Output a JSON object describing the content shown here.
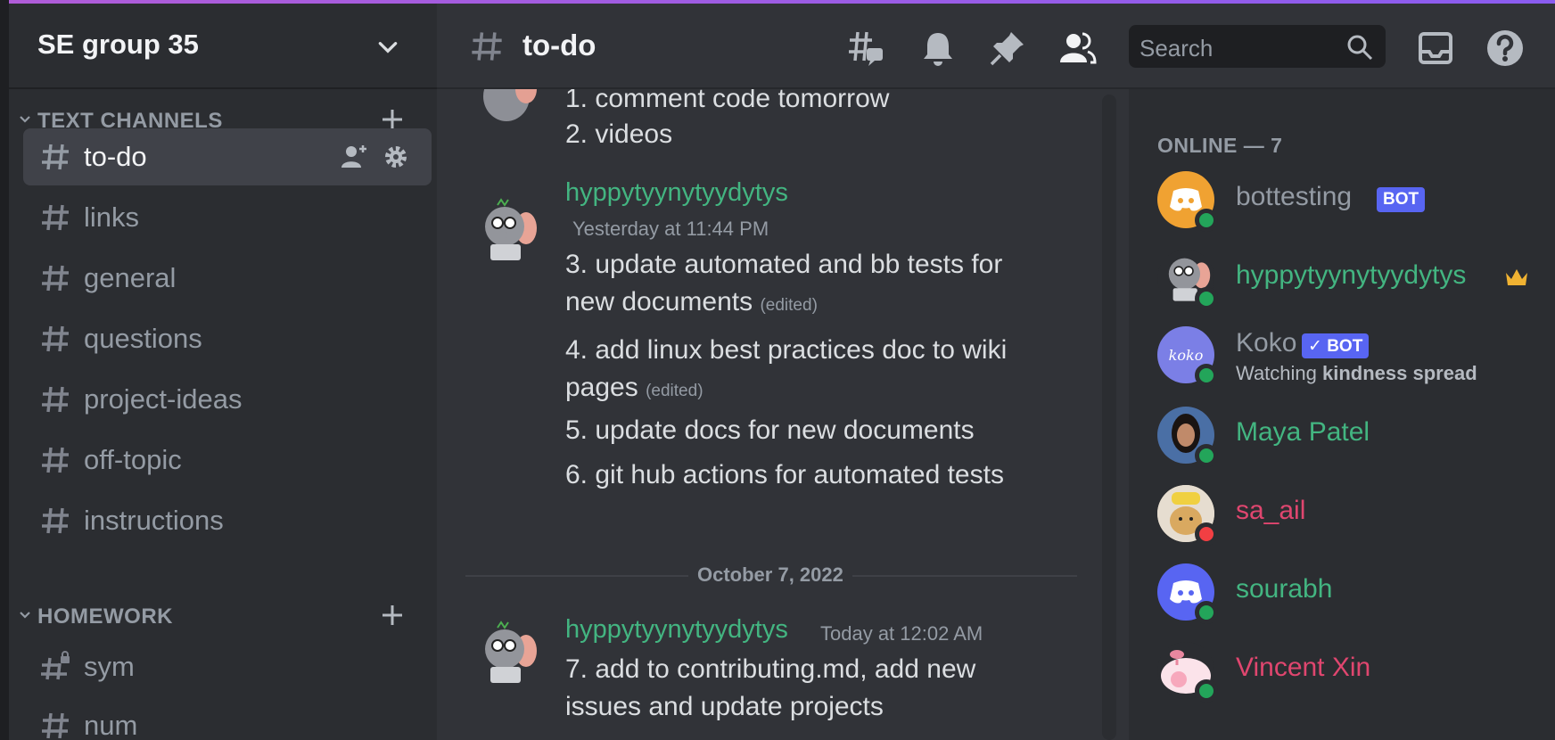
{
  "server": {
    "name": "SE group 35"
  },
  "sidebar": {
    "categories": [
      {
        "label": "TEXT CHANNELS"
      },
      {
        "label": "HOMEWORK"
      }
    ],
    "channels": [
      {
        "label": "to-do",
        "active": true
      },
      {
        "label": "links"
      },
      {
        "label": "general"
      },
      {
        "label": "questions"
      },
      {
        "label": "project-ideas"
      },
      {
        "label": "off-topic"
      },
      {
        "label": "instructions"
      }
    ],
    "homework_channels": [
      {
        "label": "sym",
        "locked": true
      },
      {
        "label": "num"
      }
    ]
  },
  "header": {
    "channel": "to-do",
    "search_placeholder": "Search",
    "icons": [
      "threads-icon",
      "bell-icon",
      "pin-icon",
      "members-icon",
      "inbox-icon",
      "help-icon"
    ]
  },
  "messages": {
    "continued": [
      "1. comment code tomorrow",
      "2. videos"
    ],
    "group1": {
      "author": "hyppytyynytyydytys",
      "timestamp": "Yesterday at 11:44 PM",
      "lines": [
        "3. update automated and bb tests for",
        "new documents",
        "4. add linux best practices doc to wiki",
        "pages",
        "5. update docs for new documents",
        "6. git hub actions for automated tests"
      ],
      "edited_label": "(edited)"
    },
    "date_divider": "October 7, 2022",
    "group2": {
      "author": "hyppytyynytyydytys",
      "timestamp": "Today at 12:02 AM",
      "lines": [
        "7. add to contributing.md, add new",
        "issues and update projects"
      ]
    }
  },
  "members": {
    "header": "ONLINE — 7",
    "list": [
      {
        "name": "bottesting",
        "badge": "BOT",
        "color": "#949ba4",
        "status": "online"
      },
      {
        "name": "hyppytyynytyydytys",
        "color": "#43b581",
        "status": "online",
        "owner": true
      },
      {
        "name": "Koko",
        "badge": "✓ BOT",
        "color": "#949ba4",
        "status": "online",
        "activity_prefix": "Watching ",
        "activity_bold": "kindness spread"
      },
      {
        "name": "Maya Patel",
        "color": "#43b581",
        "status": "online"
      },
      {
        "name": "sa_ail",
        "color": "#e0466f",
        "status": "dnd"
      },
      {
        "name": "sourabh",
        "color": "#43b581",
        "status": "online"
      },
      {
        "name": "Vincent Xin",
        "color": "#e0466f",
        "status": "online"
      }
    ]
  },
  "colors": {
    "accent": "#5865f2",
    "online": "#23a55a",
    "dnd": "#f23f43",
    "green_name": "#43b581",
    "pink_name": "#e0466f"
  }
}
